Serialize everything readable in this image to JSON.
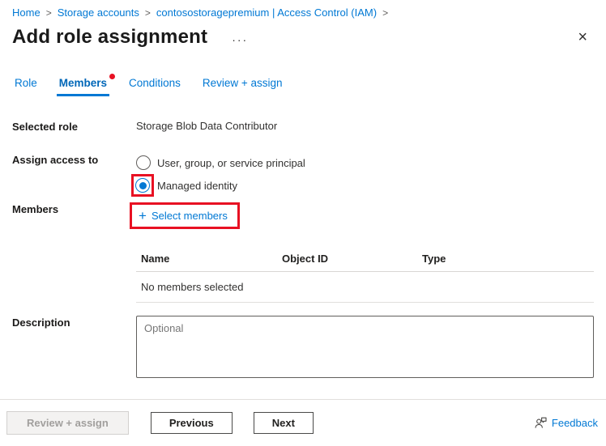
{
  "breadcrumb": {
    "separator": ">",
    "items": [
      {
        "label": "Home"
      },
      {
        "label": "Storage accounts"
      },
      {
        "label": "contosostoragepremium | Access Control (IAM)"
      }
    ]
  },
  "header": {
    "title": "Add role assignment",
    "more_label": "···",
    "close_label": "×"
  },
  "tabs": [
    {
      "label": "Role"
    },
    {
      "label": "Members"
    },
    {
      "label": "Conditions"
    },
    {
      "label": "Review + assign"
    }
  ],
  "form": {
    "selected_role": {
      "label": "Selected role",
      "value": "Storage Blob Data Contributor"
    },
    "assign_access_to": {
      "label": "Assign access to",
      "options": [
        {
          "label": "User, group, or service principal",
          "selected": false
        },
        {
          "label": "Managed identity",
          "selected": true,
          "highlighted": true
        }
      ]
    },
    "members": {
      "label": "Members",
      "plus_icon": "+",
      "select_members_label": "Select members",
      "table": {
        "columns": [
          "Name",
          "Object ID",
          "Type"
        ],
        "empty_text": "No members selected"
      }
    },
    "description": {
      "label": "Description",
      "placeholder": "Optional"
    }
  },
  "footer": {
    "review_assign_label": "Review + assign",
    "previous_label": "Previous",
    "next_label": "Next",
    "feedback_label": "Feedback"
  },
  "colors": {
    "accent": "#0078d4",
    "active_tab": "#0067b8",
    "highlight_red": "#e81123",
    "badge_red": "#e81123",
    "disabled_text": "#a19f9d",
    "divider": "#e1dfdd"
  }
}
